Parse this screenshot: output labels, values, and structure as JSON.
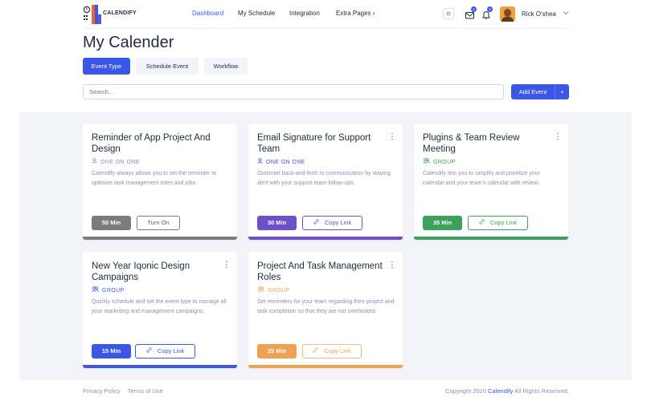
{
  "brand": {
    "name": "CALENDIFY"
  },
  "nav": {
    "dashboard": "Dashboard",
    "my_schedule": "My Schedule",
    "integration": "Integration",
    "extra_pages": "Extra Pages ›"
  },
  "header": {
    "mail_count": "4",
    "bell_count": "4",
    "user_name": "Rick O'shea"
  },
  "page": {
    "title": "My Calender"
  },
  "tabs": [
    "Event Type",
    "Schedule Event",
    "Workflow"
  ],
  "search": {
    "placeholder": "Search..."
  },
  "add_event": {
    "label": "Add Event",
    "plus": "+"
  },
  "cards": [
    {
      "title": "Reminder of App Project And Design",
      "kind": "ONE ON ONE",
      "desc": "Calendify always allows you to set the reminder to optimize task management roles and jobs.",
      "duration": "50 Min",
      "action": "Turn On",
      "color": "#7c7c7c",
      "icon": "user-icon",
      "action_icon": ""
    },
    {
      "title": "Email Signature for Support Team",
      "kind": "ONE ON ONE",
      "desc": "Outsmart back-and-forth in communication by staying alert with your support team follow-ups.",
      "duration": "30 Min",
      "action": "Copy Link",
      "color": "#6d4fc9",
      "icon": "user-icon",
      "action_icon": "link-icon"
    },
    {
      "title": "Plugins & Team Review Meeting",
      "kind": "GROUP",
      "desc": "Calendify lets you to simplify and prioritize your calendar and your team's calendar with review.",
      "duration": "35 Min",
      "action": "Copy Link",
      "color": "#3aa25a",
      "icon": "users-icon",
      "action_icon": "link-icon"
    },
    {
      "title": "New Year Iqonic Design Campaigns",
      "kind": "GROUP",
      "desc": "Quickly schedule and set the event type to manage all your marketing and management campaigns.",
      "duration": "15 Min",
      "action": "Copy Link",
      "color": "#3a57e8",
      "icon": "users-icon",
      "action_icon": "link-icon"
    },
    {
      "title": "Project And Task Management Roles",
      "kind": "GROUP",
      "desc": "Set reminders for your team regarding their project and task completion so that they are not overlooked.",
      "duration": "25 Min",
      "action": "Copy Link",
      "color": "#f0a050",
      "icon": "users-icon",
      "action_icon": "link-icon"
    }
  ],
  "footer": {
    "privacy": "Privacy Policy",
    "terms": "Terms of Use",
    "copyright_pre": "Copyright 2020",
    "copyright_brand": "Calendify",
    "copyright_post": "All Rights Reserved."
  }
}
